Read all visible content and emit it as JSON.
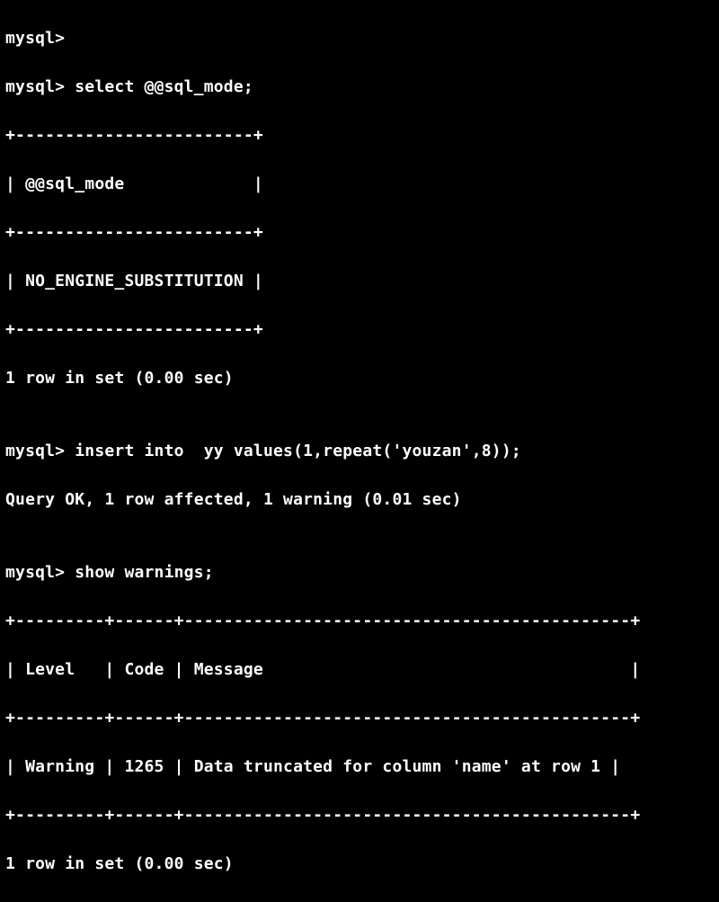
{
  "lines": {
    "l0": "mysql>",
    "l1": "mysql> select @@sql_mode;",
    "l2": "+------------------------+",
    "l3": "| @@sql_mode             |",
    "l4": "+------------------------+",
    "l5": "| NO_ENGINE_SUBSTITUTION |",
    "l6": "+------------------------+",
    "l7": "1 row in set (0.00 sec)",
    "l8": "",
    "l9": "mysql> insert into  yy values(1,repeat('youzan',8));",
    "l10": "Query OK, 1 row affected, 1 warning (0.01 sec)",
    "l11": "",
    "l12": "mysql> show warnings;",
    "l13": "+---------+------+---------------------------------------------+",
    "l14": "| Level   | Code | Message                                     |",
    "l15": "+---------+------+---------------------------------------------+",
    "l16": "| Warning | 1265 | Data truncated for column 'name' at row 1 |",
    "l17": "+---------+------+---------------------------------------------+",
    "l18": "1 row in set (0.00 sec)"
  },
  "session": {
    "prompt": "mysql>",
    "queries": [
      {
        "sql": "select @@sql_mode;",
        "result_columns": [
          "@@sql_mode"
        ],
        "result_rows": [
          [
            "NO_ENGINE_SUBSTITUTION"
          ]
        ],
        "footer": "1 row in set (0.00 sec)"
      },
      {
        "sql": "insert into  yy values(1,repeat('youzan',8));",
        "status": "Query OK, 1 row affected, 1 warning (0.01 sec)"
      },
      {
        "sql": "show warnings;",
        "result_columns": [
          "Level",
          "Code",
          "Message"
        ],
        "result_rows": [
          [
            "Warning",
            "1265",
            "Data truncated for column 'name' at row 1"
          ]
        ],
        "footer": "1 row in set (0.00 sec)"
      }
    ]
  }
}
